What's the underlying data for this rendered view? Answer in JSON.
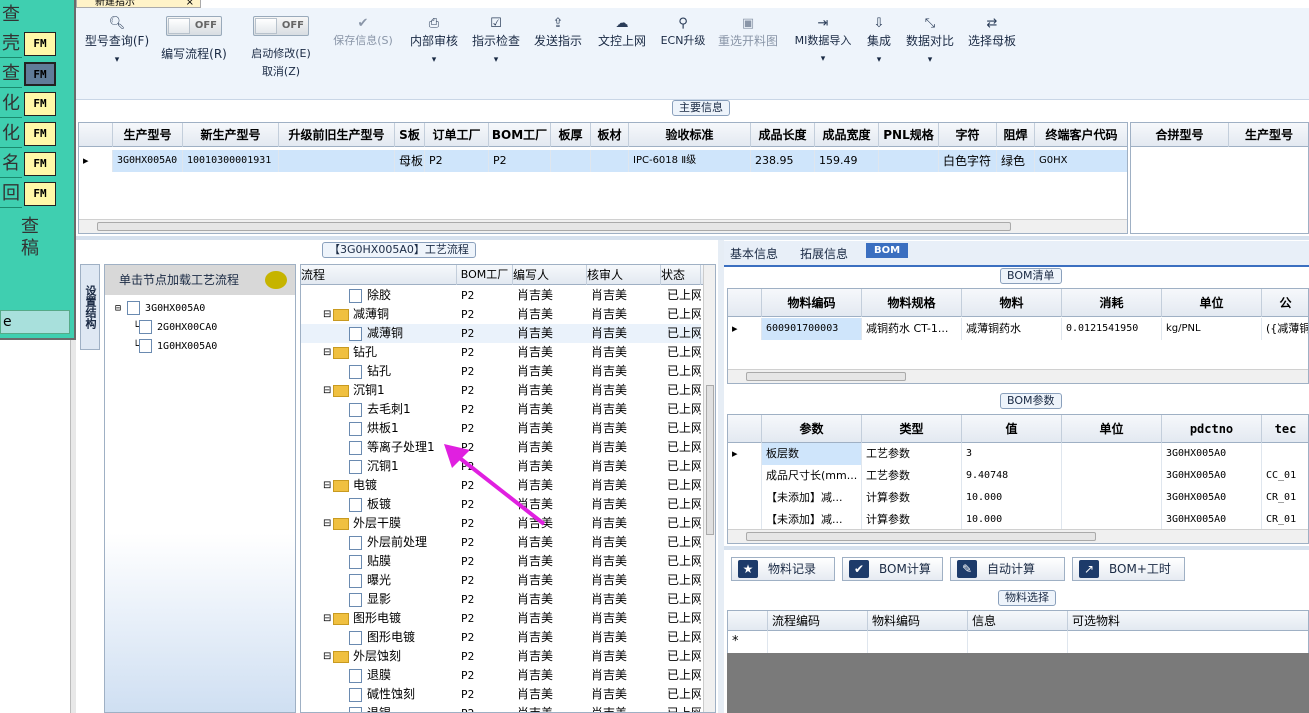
{
  "left_panel": {
    "top_char": "查",
    "cells": [
      "壳",
      "查",
      "化",
      "化",
      "名",
      "回"
    ],
    "fm_label": "FM",
    "big_text": [
      "查",
      "稿"
    ],
    "bar_text": "e"
  },
  "top_tab": {
    "label": "新建指示"
  },
  "toolbar": {
    "model_query": "型号查询(F)",
    "edit_flow": "编写流程(R)",
    "toggle_off": "OFF",
    "start_modify": "启动修改(E)",
    "cancel": "取消(Z)",
    "save_info": "保存信息(S)",
    "internal_review": "内部审核",
    "instruction_check": "指示检查",
    "send_instruction": "发送指示",
    "doc_upload": "文控上网",
    "ecn_upgrade": "ECN升级",
    "reselect_image": "重选开料图",
    "mi_import": "MI数据导入",
    "integrate": "集成",
    "data_compare": "数据对比",
    "select_master": "选择母板"
  },
  "main_info": {
    "title": "主要信息",
    "columns": [
      "生产型号",
      "新生产型号",
      "升级前旧生产型号",
      "S板",
      "订单工厂",
      "BOM工厂",
      "板厚",
      "板材",
      "验收标准",
      "成品长度",
      "成品宽度",
      "PNL规格",
      "字符",
      "阻焊",
      "终端客户代码"
    ],
    "row": [
      "3G0HX005A0",
      "10010300001931",
      "",
      "母板",
      "P2",
      "P2",
      "",
      "",
      "IPC-6018 Ⅱ级",
      "238.95",
      "159.49",
      "",
      "白色字符",
      "绿色",
      "G0HX"
    ],
    "side_columns": [
      "合拼型号",
      "生产型号"
    ]
  },
  "flow_section": {
    "title": "【3G0HX005A0】工艺流程",
    "vtab": "设置结构",
    "tree_header": "单击节点加载工艺流程",
    "tree_root": "3G0HX005A0",
    "tree_children": [
      "2G0HX00CA0",
      "1G0HX005A0"
    ],
    "columns": [
      "流程",
      "BOM工厂",
      "编写人",
      "核审人",
      "状态"
    ],
    "rows": [
      {
        "name": "除胶",
        "level": 2,
        "factory": "P2",
        "writer": "肖吉美",
        "reviewer": "肖吉美",
        "status": "已上网"
      },
      {
        "name": "减薄铜",
        "level": 1,
        "factory": "P2",
        "writer": "肖吉美",
        "reviewer": "肖吉美",
        "status": "已上网"
      },
      {
        "name": "减薄铜",
        "level": 2,
        "factory": "P2",
        "writer": "肖吉美",
        "reviewer": "肖吉美",
        "status": "已上网"
      },
      {
        "name": "钻孔",
        "level": 1,
        "factory": "P2",
        "writer": "肖吉美",
        "reviewer": "肖吉美",
        "status": "已上网"
      },
      {
        "name": "钻孔",
        "level": 2,
        "factory": "P2",
        "writer": "肖吉美",
        "reviewer": "肖吉美",
        "status": "已上网"
      },
      {
        "name": "沉铜1",
        "level": 1,
        "factory": "P2",
        "writer": "肖吉美",
        "reviewer": "肖吉美",
        "status": "已上网"
      },
      {
        "name": "去毛刺1",
        "level": 2,
        "factory": "P2",
        "writer": "肖吉美",
        "reviewer": "肖吉美",
        "status": "已上网"
      },
      {
        "name": "烘板1",
        "level": 2,
        "factory": "P2",
        "writer": "肖吉美",
        "reviewer": "肖吉美",
        "status": "已上网"
      },
      {
        "name": "等离子处理1",
        "level": 2,
        "factory": "P2",
        "writer": "肖吉美",
        "reviewer": "肖吉美",
        "status": "已上网"
      },
      {
        "name": "沉铜1",
        "level": 2,
        "factory": "P2",
        "writer": "肖吉美",
        "reviewer": "肖吉美",
        "status": "已上网"
      },
      {
        "name": "电镀",
        "level": 1,
        "factory": "P2",
        "writer": "肖吉美",
        "reviewer": "肖吉美",
        "status": "已上网"
      },
      {
        "name": "板镀",
        "level": 2,
        "factory": "P2",
        "writer": "肖吉美",
        "reviewer": "肖吉美",
        "status": "已上网"
      },
      {
        "name": "外层干膜",
        "level": 1,
        "factory": "P2",
        "writer": "肖吉美",
        "reviewer": "肖吉美",
        "status": "已上网"
      },
      {
        "name": "外层前处理",
        "level": 2,
        "factory": "P2",
        "writer": "肖吉美",
        "reviewer": "肖吉美",
        "status": "已上网"
      },
      {
        "name": "贴膜",
        "level": 2,
        "factory": "P2",
        "writer": "肖吉美",
        "reviewer": "肖吉美",
        "status": "已上网"
      },
      {
        "name": "曝光",
        "level": 2,
        "factory": "P2",
        "writer": "肖吉美",
        "reviewer": "肖吉美",
        "status": "已上网"
      },
      {
        "name": "显影",
        "level": 2,
        "factory": "P2",
        "writer": "肖吉美",
        "reviewer": "肖吉美",
        "status": "已上网"
      },
      {
        "name": "图形电镀",
        "level": 1,
        "factory": "P2",
        "writer": "肖吉美",
        "reviewer": "肖吉美",
        "status": "已上网"
      },
      {
        "name": "图形电镀",
        "level": 2,
        "factory": "P2",
        "writer": "肖吉美",
        "reviewer": "肖吉美",
        "status": "已上网"
      },
      {
        "name": "外层蚀刻",
        "level": 1,
        "factory": "P2",
        "writer": "肖吉美",
        "reviewer": "肖吉美",
        "status": "已上网"
      },
      {
        "name": "退膜",
        "level": 2,
        "factory": "P2",
        "writer": "肖吉美",
        "reviewer": "肖吉美",
        "status": "已上网"
      },
      {
        "name": "碱性蚀刻",
        "level": 2,
        "factory": "P2",
        "writer": "肖吉美",
        "reviewer": "肖吉美",
        "status": "已上网"
      },
      {
        "name": "退锡",
        "level": 2,
        "factory": "P2",
        "writer": "肖吉美",
        "reviewer": "肖吉美",
        "status": "已上网"
      }
    ]
  },
  "right_tabs": [
    "基本信息",
    "拓展信息",
    "BOM"
  ],
  "bom_list": {
    "title": "BOM清单",
    "columns": [
      "物料编码",
      "物料规格",
      "物料",
      "消耗",
      "单位",
      "公"
    ],
    "row": [
      "600901700003",
      "减铜药水 CT-1...",
      "减薄铜药水",
      "0.0121541950",
      "kg/PNL",
      "({减薄铜"
    ]
  },
  "bom_params": {
    "title": "BOM参数",
    "columns": [
      "参数",
      "类型",
      "值",
      "单位",
      "pdctno",
      "tec"
    ],
    "rows": [
      [
        "板层数",
        "工艺参数",
        "3",
        "",
        "3G0HX005A0",
        ""
      ],
      [
        "成品尺寸长(mm...",
        "工艺参数",
        "9.40748",
        "",
        "3G0HX005A0",
        "CC_01"
      ],
      [
        "【未添加】减...",
        "计算参数",
        "10.000",
        "",
        "3G0HX005A0",
        "CR_01"
      ],
      [
        "【未添加】减...",
        "计算参数",
        "10.000",
        "",
        "3G0HX005A0",
        "CR_01"
      ]
    ]
  },
  "bom_buttons": [
    "物料记录",
    "BOM计算",
    "自动计算",
    "BOM+工时"
  ],
  "material_select": {
    "title": "物料选择",
    "columns": [
      "流程编码",
      "物料编码",
      "信息",
      "可选物料"
    ],
    "new_row_marker": "*"
  }
}
